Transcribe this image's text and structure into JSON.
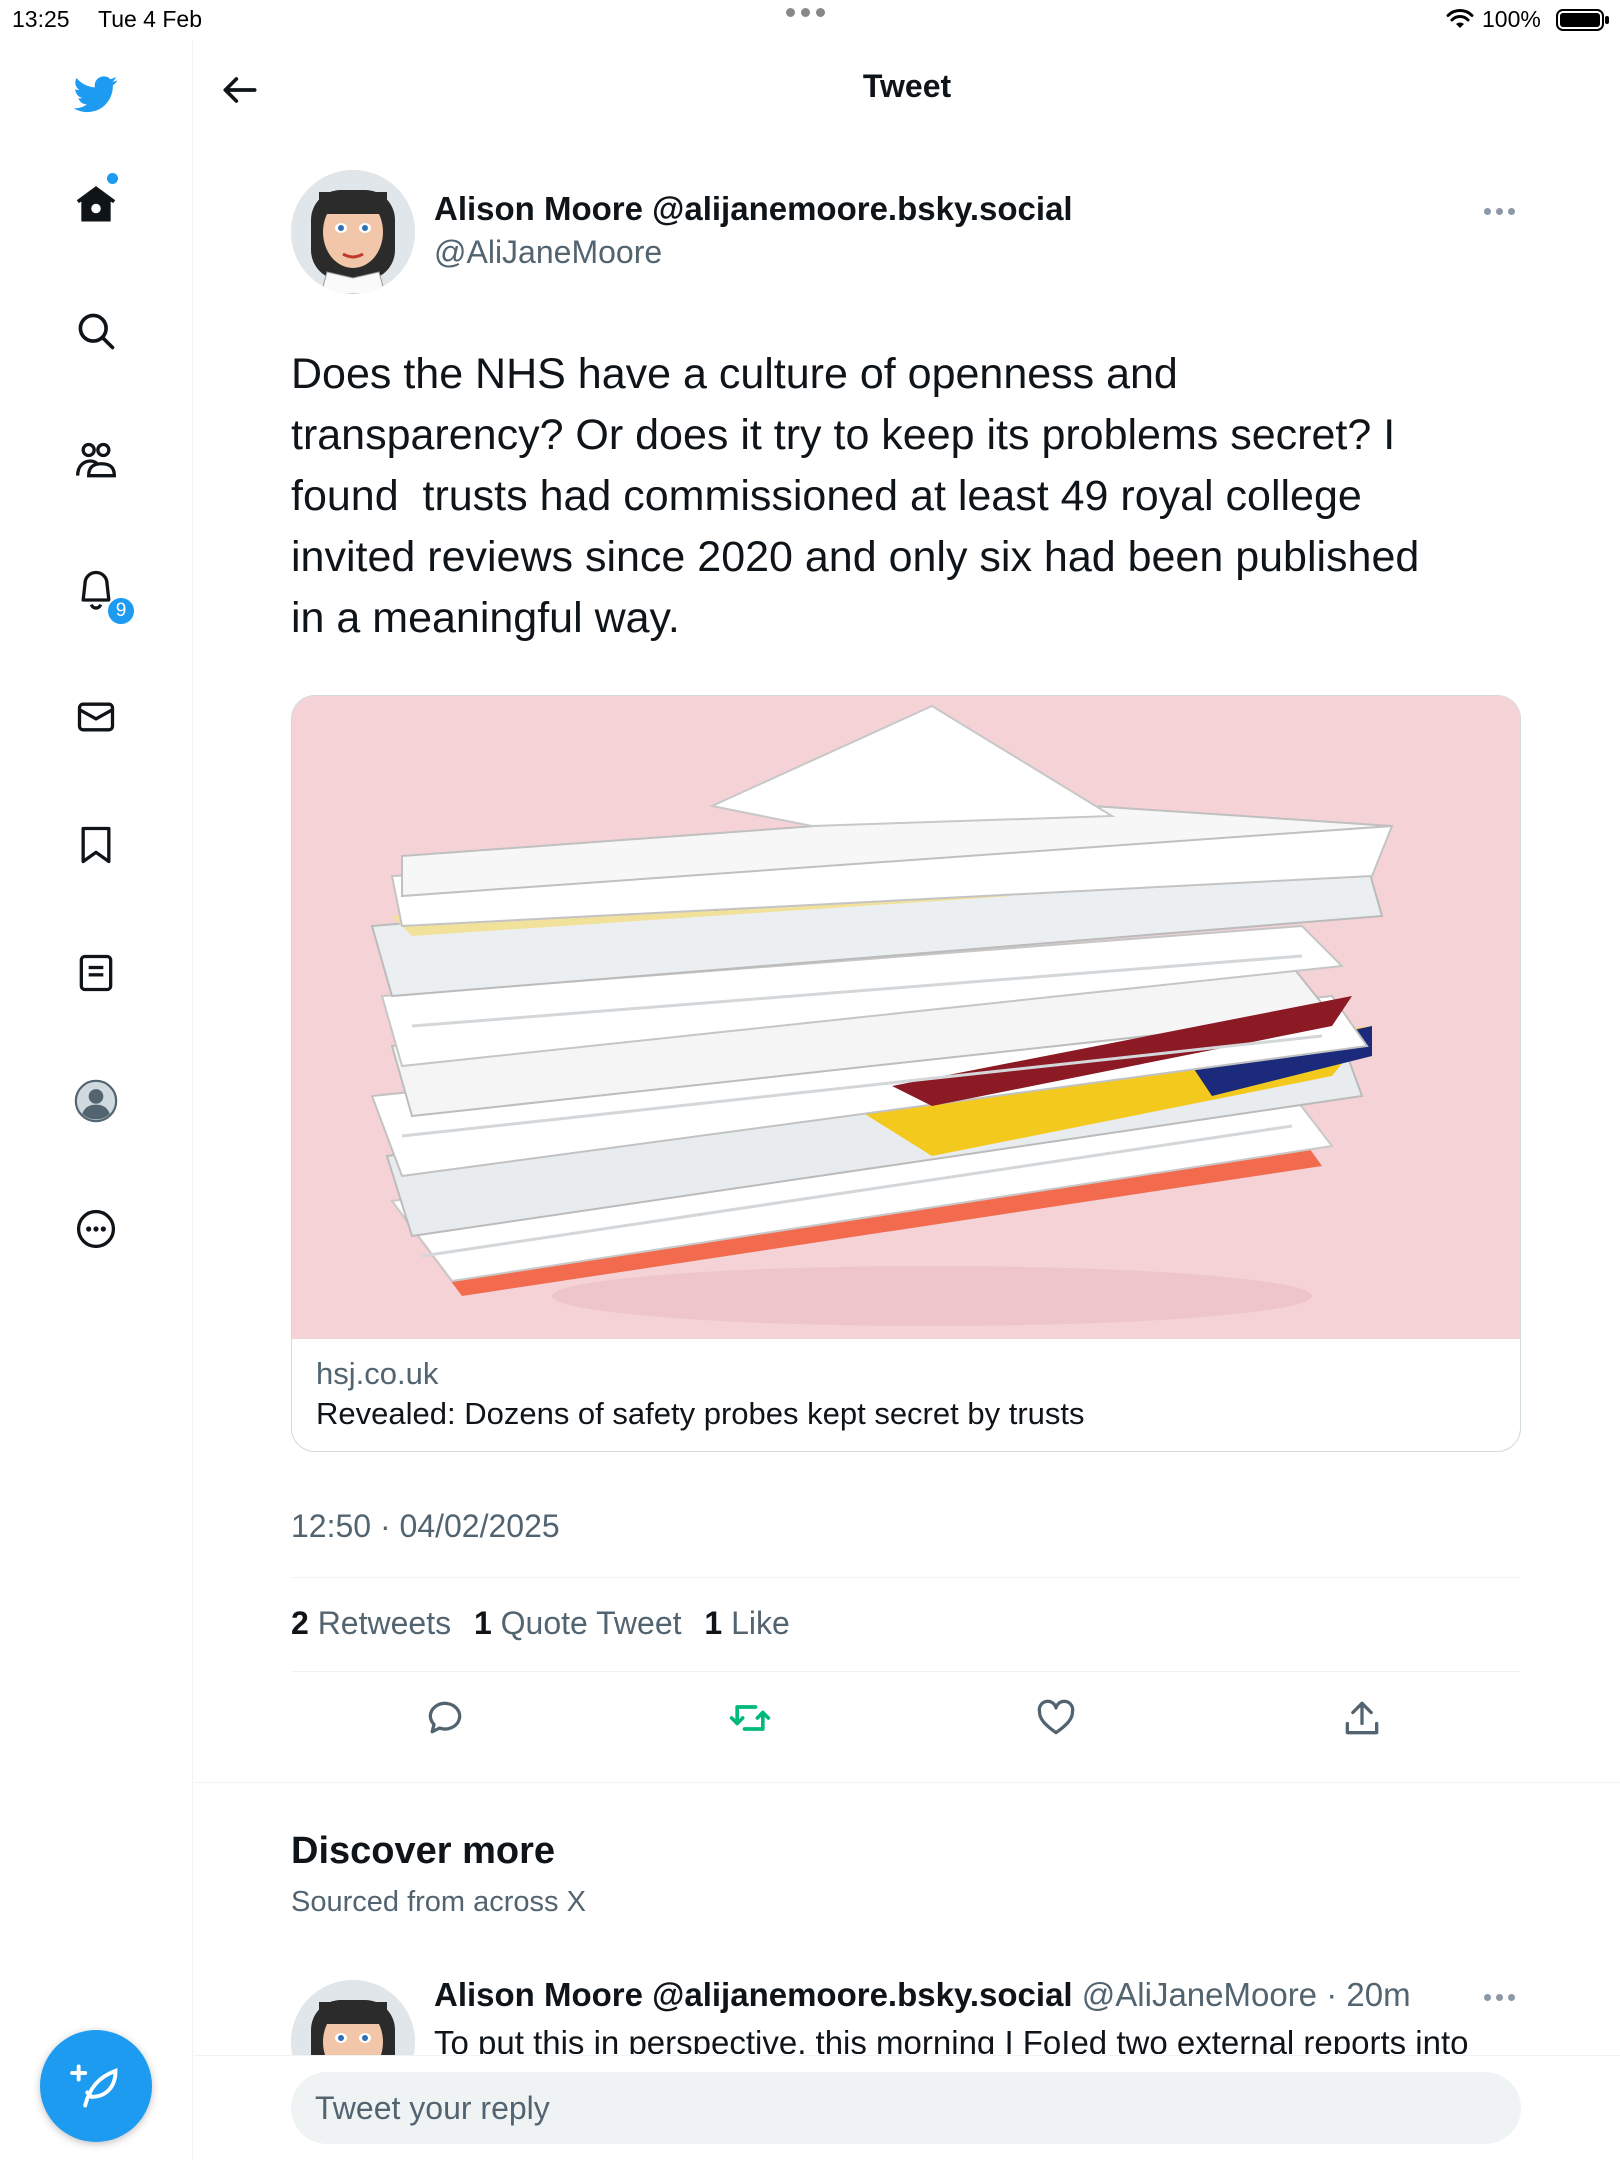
{
  "status_bar": {
    "time": "13:25",
    "date": "Tue 4 Feb",
    "battery": "100%"
  },
  "sidebar": {
    "items": [
      {
        "name": "twitter-logo",
        "icon": "bird-icon"
      },
      {
        "name": "home",
        "icon": "home-icon"
      },
      {
        "name": "explore",
        "icon": "search-icon"
      },
      {
        "name": "communities",
        "icon": "people-icon"
      },
      {
        "name": "notifications",
        "icon": "bell-icon"
      },
      {
        "name": "messages",
        "icon": "mail-icon"
      },
      {
        "name": "bookmarks",
        "icon": "bookmark-icon"
      },
      {
        "name": "lists",
        "icon": "list-icon"
      },
      {
        "name": "profile",
        "icon": "profile-icon"
      },
      {
        "name": "more",
        "icon": "more-circle-icon"
      }
    ],
    "notifications_badge": "9",
    "accent": "#1d9bf0"
  },
  "header": {
    "title": "Tweet"
  },
  "tweet": {
    "author_name": "Alison Moore @alijanemoore.bsky.social",
    "author_handle": "@AliJaneMoore",
    "text": "Does the NHS have a culture of openness and\ntransparency? Or does it try to keep its problems secret? I\nfound  trusts had commissioned at least 49 royal college\ninvited reviews since 2020 and only six had been published\nin a meaningful way.",
    "card": {
      "domain": "hsj.co.uk",
      "title": "Revealed: Dozens of safety probes kept secret by trusts"
    },
    "timestamp": "12:50 · 04/02/2025",
    "stats": {
      "retweets_count": "2",
      "retweets_label": "Retweets",
      "quotes_count": "1",
      "quotes_label": "Quote Tweet",
      "likes_count": "1",
      "likes_label": "Like"
    },
    "retweet_color": "#00ba7c"
  },
  "discover": {
    "title": "Discover more",
    "subtitle": "Sourced from across X",
    "items": [
      {
        "author_name": "Alison Moore @alijanemoore.bsky.social",
        "meta": "@AliJaneMoore · 20m",
        "text": "To put this in perspective, this morning I FoIed two external reports into"
      }
    ]
  },
  "reply": {
    "placeholder": "Tweet your reply"
  }
}
